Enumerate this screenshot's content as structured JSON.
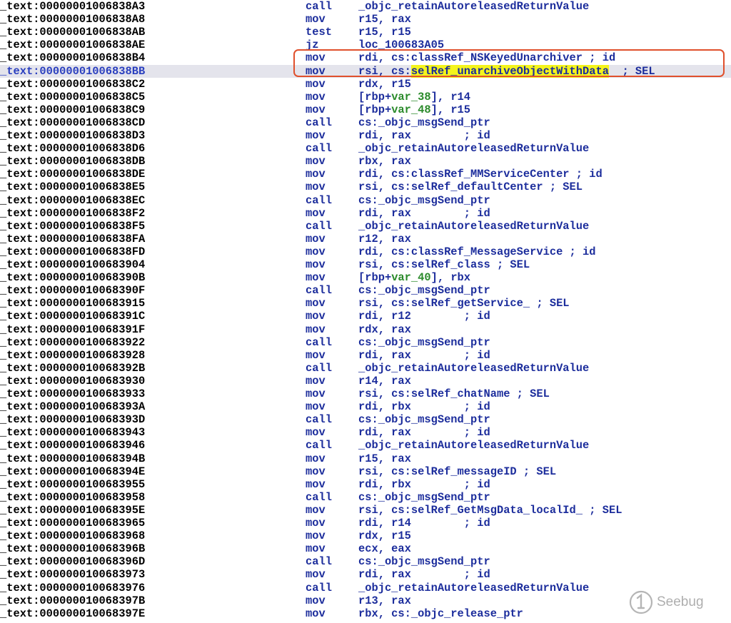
{
  "highlight_color": "#f4f41c",
  "box_color": "#e0502c",
  "selected_row": 5,
  "boxed_rows": [
    4,
    5
  ],
  "watermark": {
    "text": "Seebug",
    "icon": "seebug-logo-icon"
  },
  "lines": [
    {
      "seg": "_text",
      "addr": ":00000001006838A3",
      "mnem": "call",
      "ops": [
        {
          "t": "_objc_retainAutoreleasedReturnValue"
        }
      ]
    },
    {
      "seg": "_text",
      "addr": ":00000001006838A8",
      "mnem": "mov",
      "ops": [
        {
          "t": "r15, rax"
        }
      ]
    },
    {
      "seg": "_text",
      "addr": ":00000001006838AB",
      "mnem": "test",
      "ops": [
        {
          "t": "r15, r15"
        }
      ]
    },
    {
      "seg": "_text",
      "addr": ":00000001006838AE",
      "mnem": "jz",
      "ops": [
        {
          "t": "loc_100683A05"
        }
      ]
    },
    {
      "seg": "_text",
      "addr": ":00000001006838B4",
      "mnem": "mov",
      "ops": [
        {
          "t": "rdi, cs:classRef_NSKeyedUnarchiver ; id"
        }
      ]
    },
    {
      "seg": "_text",
      "addr": ":00000001006838BB",
      "mnem": "mov",
      "ops": [
        {
          "t": "rsi, cs:"
        },
        {
          "t": "selRef_unarchiveObjectWithData",
          "hl": true
        },
        {
          "t": "  ; SEL"
        }
      ]
    },
    {
      "seg": "_text",
      "addr": ":00000001006838C2",
      "mnem": "mov",
      "ops": [
        {
          "t": "rdx, r15"
        }
      ]
    },
    {
      "seg": "_text",
      "addr": ":00000001006838C5",
      "mnem": "mov",
      "ops": [
        {
          "t": "[rbp+"
        },
        {
          "t": "var_38",
          "g": true
        },
        {
          "t": "], r14"
        }
      ]
    },
    {
      "seg": "_text",
      "addr": ":00000001006838C9",
      "mnem": "mov",
      "ops": [
        {
          "t": "[rbp+"
        },
        {
          "t": "var_48",
          "g": true
        },
        {
          "t": "], r15"
        }
      ]
    },
    {
      "seg": "_text",
      "addr": ":00000001006838CD",
      "mnem": "call",
      "ops": [
        {
          "t": "cs:_objc_msgSend_ptr"
        }
      ]
    },
    {
      "seg": "_text",
      "addr": ":00000001006838D3",
      "mnem": "mov",
      "ops": [
        {
          "t": "rdi, rax        ; id"
        }
      ]
    },
    {
      "seg": "_text",
      "addr": ":00000001006838D6",
      "mnem": "call",
      "ops": [
        {
          "t": "_objc_retainAutoreleasedReturnValue"
        }
      ]
    },
    {
      "seg": "_text",
      "addr": ":00000001006838DB",
      "mnem": "mov",
      "ops": [
        {
          "t": "rbx, rax"
        }
      ]
    },
    {
      "seg": "_text",
      "addr": ":00000001006838DE",
      "mnem": "mov",
      "ops": [
        {
          "t": "rdi, cs:classRef_MMServiceCenter ; id"
        }
      ]
    },
    {
      "seg": "_text",
      "addr": ":00000001006838E5",
      "mnem": "mov",
      "ops": [
        {
          "t": "rsi, cs:selRef_defaultCenter ; SEL"
        }
      ]
    },
    {
      "seg": "_text",
      "addr": ":00000001006838EC",
      "mnem": "call",
      "ops": [
        {
          "t": "cs:_objc_msgSend_ptr"
        }
      ]
    },
    {
      "seg": "_text",
      "addr": ":00000001006838F2",
      "mnem": "mov",
      "ops": [
        {
          "t": "rdi, rax        ; id"
        }
      ]
    },
    {
      "seg": "_text",
      "addr": ":00000001006838F5",
      "mnem": "call",
      "ops": [
        {
          "t": "_objc_retainAutoreleasedReturnValue"
        }
      ]
    },
    {
      "seg": "_text",
      "addr": ":00000001006838FA",
      "mnem": "mov",
      "ops": [
        {
          "t": "r12, rax"
        }
      ]
    },
    {
      "seg": "_text",
      "addr": ":00000001006838FD",
      "mnem": "mov",
      "ops": [
        {
          "t": "rdi, cs:classRef_MessageService ; id"
        }
      ]
    },
    {
      "seg": "_text",
      "addr": ":0000000100683904",
      "mnem": "mov",
      "ops": [
        {
          "t": "rsi, cs:selRef_class ; SEL"
        }
      ]
    },
    {
      "seg": "_text",
      "addr": ":000000010068390B",
      "mnem": "mov",
      "ops": [
        {
          "t": "[rbp+"
        },
        {
          "t": "var_40",
          "g": true
        },
        {
          "t": "], rbx"
        }
      ]
    },
    {
      "seg": "_text",
      "addr": ":000000010068390F",
      "mnem": "call",
      "ops": [
        {
          "t": "cs:_objc_msgSend_ptr"
        }
      ]
    },
    {
      "seg": "_text",
      "addr": ":0000000100683915",
      "mnem": "mov",
      "ops": [
        {
          "t": "rsi, cs:selRef_getService_ ; SEL"
        }
      ]
    },
    {
      "seg": "_text",
      "addr": ":000000010068391C",
      "mnem": "mov",
      "ops": [
        {
          "t": "rdi, r12        ; id"
        }
      ]
    },
    {
      "seg": "_text",
      "addr": ":000000010068391F",
      "mnem": "mov",
      "ops": [
        {
          "t": "rdx, rax"
        }
      ]
    },
    {
      "seg": "_text",
      "addr": ":0000000100683922",
      "mnem": "call",
      "ops": [
        {
          "t": "cs:_objc_msgSend_ptr"
        }
      ]
    },
    {
      "seg": "_text",
      "addr": ":0000000100683928",
      "mnem": "mov",
      "ops": [
        {
          "t": "rdi, rax        ; id"
        }
      ]
    },
    {
      "seg": "_text",
      "addr": ":000000010068392B",
      "mnem": "call",
      "ops": [
        {
          "t": "_objc_retainAutoreleasedReturnValue"
        }
      ]
    },
    {
      "seg": "_text",
      "addr": ":0000000100683930",
      "mnem": "mov",
      "ops": [
        {
          "t": "r14, rax"
        }
      ]
    },
    {
      "seg": "_text",
      "addr": ":0000000100683933",
      "mnem": "mov",
      "ops": [
        {
          "t": "rsi, cs:selRef_chatName ; SEL"
        }
      ]
    },
    {
      "seg": "_text",
      "addr": ":000000010068393A",
      "mnem": "mov",
      "ops": [
        {
          "t": "rdi, rbx        ; id"
        }
      ]
    },
    {
      "seg": "_text",
      "addr": ":000000010068393D",
      "mnem": "call",
      "ops": [
        {
          "t": "cs:_objc_msgSend_ptr"
        }
      ]
    },
    {
      "seg": "_text",
      "addr": ":0000000100683943",
      "mnem": "mov",
      "ops": [
        {
          "t": "rdi, rax        ; id"
        }
      ]
    },
    {
      "seg": "_text",
      "addr": ":0000000100683946",
      "mnem": "call",
      "ops": [
        {
          "t": "_objc_retainAutoreleasedReturnValue"
        }
      ]
    },
    {
      "seg": "_text",
      "addr": ":000000010068394B",
      "mnem": "mov",
      "ops": [
        {
          "t": "r15, rax"
        }
      ]
    },
    {
      "seg": "_text",
      "addr": ":000000010068394E",
      "mnem": "mov",
      "ops": [
        {
          "t": "rsi, cs:selRef_messageID ; SEL"
        }
      ]
    },
    {
      "seg": "_text",
      "addr": ":0000000100683955",
      "mnem": "mov",
      "ops": [
        {
          "t": "rdi, rbx        ; id"
        }
      ]
    },
    {
      "seg": "_text",
      "addr": ":0000000100683958",
      "mnem": "call",
      "ops": [
        {
          "t": "cs:_objc_msgSend_ptr"
        }
      ]
    },
    {
      "seg": "_text",
      "addr": ":000000010068395E",
      "mnem": "mov",
      "ops": [
        {
          "t": "rsi, cs:selRef_GetMsgData_localId_ ; SEL"
        }
      ]
    },
    {
      "seg": "_text",
      "addr": ":0000000100683965",
      "mnem": "mov",
      "ops": [
        {
          "t": "rdi, r14        ; id"
        }
      ]
    },
    {
      "seg": "_text",
      "addr": ":0000000100683968",
      "mnem": "mov",
      "ops": [
        {
          "t": "rdx, r15"
        }
      ]
    },
    {
      "seg": "_text",
      "addr": ":000000010068396B",
      "mnem": "mov",
      "ops": [
        {
          "t": "ecx, eax"
        }
      ]
    },
    {
      "seg": "_text",
      "addr": ":000000010068396D",
      "mnem": "call",
      "ops": [
        {
          "t": "cs:_objc_msgSend_ptr"
        }
      ]
    },
    {
      "seg": "_text",
      "addr": ":0000000100683973",
      "mnem": "mov",
      "ops": [
        {
          "t": "rdi, rax        ; id"
        }
      ]
    },
    {
      "seg": "_text",
      "addr": ":0000000100683976",
      "mnem": "call",
      "ops": [
        {
          "t": "_objc_retainAutoreleasedReturnValue"
        }
      ]
    },
    {
      "seg": "_text",
      "addr": ":000000010068397B",
      "mnem": "mov",
      "ops": [
        {
          "t": "r13, rax"
        }
      ]
    },
    {
      "seg": "_text",
      "addr": ":000000010068397E",
      "mnem": "mov",
      "ops": [
        {
          "t": "rbx, cs:_objc_release_ptr"
        }
      ]
    }
  ]
}
